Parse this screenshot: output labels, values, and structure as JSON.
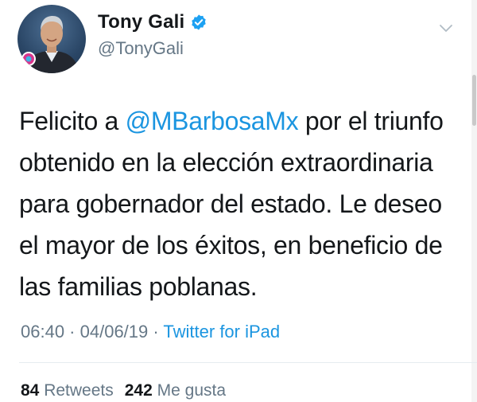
{
  "author": {
    "display_name": "Tony Gali",
    "handle": "@TonyGali",
    "verified": true
  },
  "tweet": {
    "text_before": "Felicito a ",
    "mention": "@MBarbosaMx",
    "text_after": " por el triunfo obtenido en la elección extraordinaria para gobernador del estado. Le deseo el mayor de los éxitos, en beneficio de las familias poblanas."
  },
  "meta": {
    "time": "06:40",
    "sep1": " · ",
    "date": "04/06/19",
    "sep2": " · ",
    "source": "Twitter for iPad"
  },
  "stats": {
    "retweets_count": "84",
    "retweets_label": "Retweets",
    "likes_count": "242",
    "likes_label": "Me gusta"
  },
  "icons": {
    "verified": "verified-badge-icon",
    "menu": "chevron-down-icon"
  },
  "colors": {
    "link": "#1b95e0",
    "secondary_text": "#657786",
    "primary_text": "#14171a",
    "verified": "#1da1f2"
  }
}
